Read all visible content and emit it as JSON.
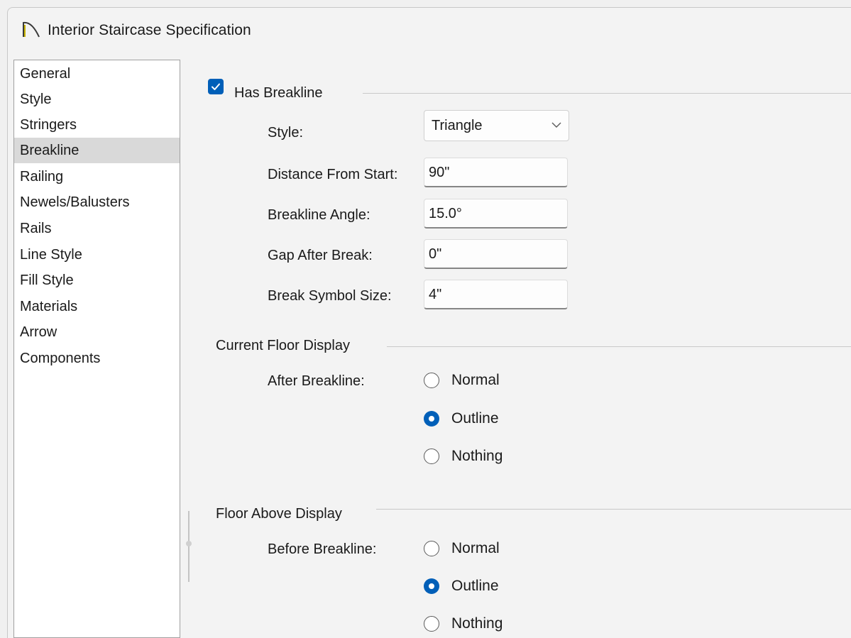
{
  "window": {
    "title": "Interior Staircase Specification"
  },
  "nav": {
    "items": [
      {
        "label": "General"
      },
      {
        "label": "Style"
      },
      {
        "label": "Stringers"
      },
      {
        "label": "Breakline"
      },
      {
        "label": "Railing"
      },
      {
        "label": "Newels/Balusters"
      },
      {
        "label": "Rails"
      },
      {
        "label": "Line Style"
      },
      {
        "label": "Fill Style"
      },
      {
        "label": "Materials"
      },
      {
        "label": "Arrow"
      },
      {
        "label": "Components"
      }
    ],
    "selected": "Breakline"
  },
  "breakline": {
    "has_breakline_label": "Has Breakline",
    "has_breakline_checked": true,
    "style_label": "Style:",
    "style_value": "Triangle",
    "distance_label": "Distance From Start:",
    "distance_value": "90\"",
    "angle_label": "Breakline Angle:",
    "angle_value": "15.0°",
    "gap_label": "Gap After Break:",
    "gap_value": "0\"",
    "symbol_size_label": "Break Symbol Size:",
    "symbol_size_value": "4\""
  },
  "current_floor": {
    "group_label": "Current Floor Display",
    "row_label": "After Breakline:",
    "options": [
      {
        "label": "Normal",
        "selected": false
      },
      {
        "label": "Outline",
        "selected": true
      },
      {
        "label": "Nothing",
        "selected": false
      }
    ]
  },
  "floor_above": {
    "group_label": "Floor Above Display",
    "row_label": "Before Breakline:",
    "options": [
      {
        "label": "Normal",
        "selected": false
      },
      {
        "label": "Outline",
        "selected": true
      },
      {
        "label": "Nothing",
        "selected": false
      }
    ]
  },
  "colors": {
    "accent": "#005fb8",
    "selected_nav": "#d9d9d9"
  }
}
